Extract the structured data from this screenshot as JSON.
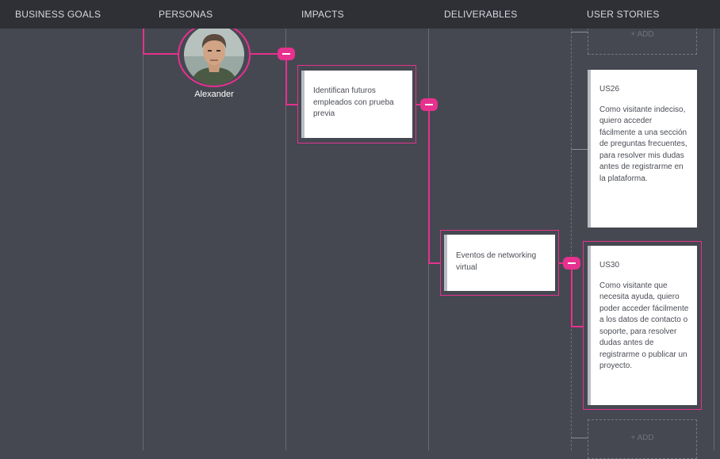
{
  "columns": [
    {
      "label": "BUSINESS GOALS"
    },
    {
      "label": "PERSONAS"
    },
    {
      "label": "IMPACTS"
    },
    {
      "label": "DELIVERABLES"
    },
    {
      "label": "USER STORIES"
    }
  ],
  "persona": {
    "name": "Alexander",
    "avatar_icon": "person-photo"
  },
  "impact": {
    "text": "Identifican futuros empleados con prueba previa"
  },
  "deliverable": {
    "text": "Eventos de networking virtual"
  },
  "user_stories": [
    {
      "id": "US26",
      "text": "Como visitante indeciso, quiero acceder fácilmente a una sección de preguntas frecuentes, para resolver mis dudas antes de registrarme en la plataforma."
    },
    {
      "id": "US30",
      "text": "Como visitante que necesita ayuda, quiero poder acceder fácilmente a los datos de contacto o soporte, para resolver dudas antes de registrarme o publicar un proyecto."
    }
  ],
  "add_label": "+ ADD",
  "colors": {
    "accent": "#e6318f",
    "background": "#454850",
    "header": "#2e3036"
  }
}
